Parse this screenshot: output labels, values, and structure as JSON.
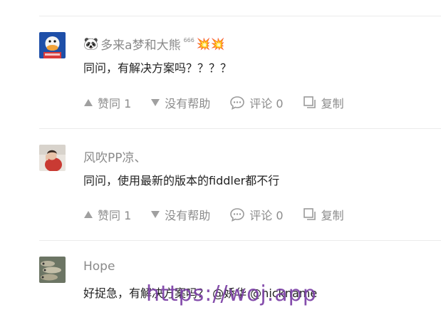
{
  "comments": [
    {
      "author": "多来a梦和大熊",
      "author_suffix": "666",
      "author_emojis": "💥💥",
      "text": "同问，有解决方案吗？？？？",
      "actions": {
        "upvote": "赞同 1",
        "downvote": "没有帮助",
        "comment": "评论 0",
        "copy": "复制"
      }
    },
    {
      "author": "风吹PP凉、",
      "text": "同问，使用最新的版本的fiddler都不行",
      "actions": {
        "upvote": "赞同 1",
        "downvote": "没有帮助",
        "comment": "评论 0",
        "copy": "复制"
      }
    },
    {
      "author": "Hope",
      "text": "好捉急，有解决方案吗？ @娇华 @nickname"
    }
  ],
  "watermark": "https://woj.app"
}
